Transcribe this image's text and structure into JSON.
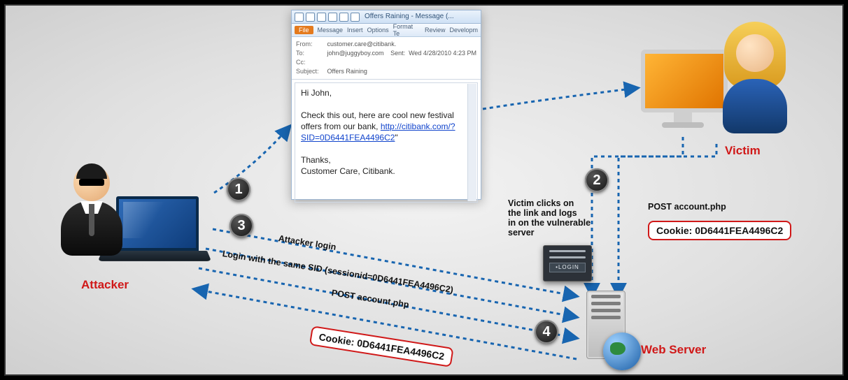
{
  "labels": {
    "attacker": "Attacker",
    "victim": "Victim",
    "server": "Web Server"
  },
  "steps": {
    "s1": "1",
    "s2": "2",
    "s3": "3",
    "s4": "4"
  },
  "edge_text": {
    "victim_click": "Victim clicks on\nthe link and logs\nin on the vulnerable\nserver",
    "post1": "POST account.php",
    "login_same_sid": "Login with the same SID (sessionid=0D6441FEA4496C2)",
    "attacker_login": "Attacker login",
    "post2": "POST account.php"
  },
  "cookies": {
    "right": "Cookie: 0D6441FEA4496C2",
    "left": "Cookie: 0D6441FEA4496C2"
  },
  "login_card": {
    "button": "•LOGIN"
  },
  "email": {
    "window_title": "Offers Raining - Message (...",
    "tabs": [
      "Message",
      "Insert",
      "Options",
      "Format Te",
      "Review",
      "Developm"
    ],
    "file_tab": "File",
    "headers": {
      "from_label": "From:",
      "from": "customer.care@citibank.",
      "to_label": "To:",
      "to": "john@juggyboy.com",
      "cc_label": "Cc:",
      "cc": "",
      "subject_label": "Subject:",
      "subject": "Offers Raining",
      "sent_label": "Sent:",
      "sent": "Wed 4/28/2010 4:23 PM"
    },
    "body": {
      "greeting": "Hi John,",
      "line": "Check this out, here are cool new festival offers from our bank, ",
      "link": "http://citibank.com/?SID=0D6441FEA4496C2",
      "quote": "\"",
      "sign1": "Thanks,",
      "sign2": "Customer Care, Citibank."
    }
  }
}
